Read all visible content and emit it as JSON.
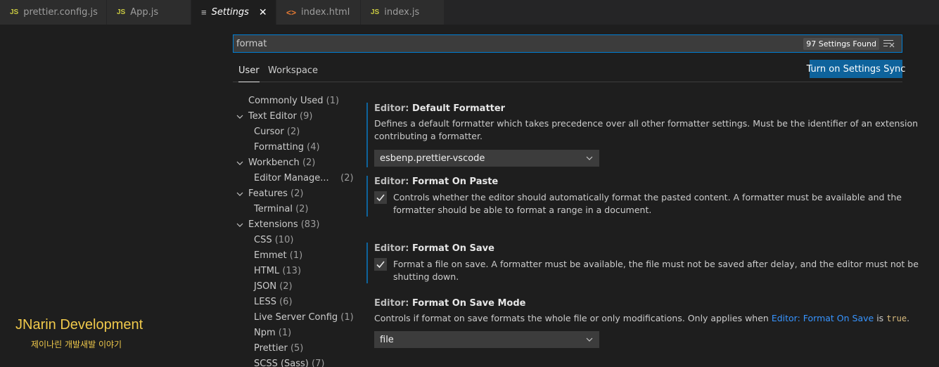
{
  "tabs": [
    {
      "icon": "JS",
      "label": "prettier.config.js"
    },
    {
      "icon": "JS",
      "label": "App.js"
    },
    {
      "icon": "≡",
      "label": "Settings",
      "active": true
    },
    {
      "icon": "<>",
      "label": "index.html"
    },
    {
      "icon": "JS",
      "label": "index.js"
    }
  ],
  "search": {
    "value": "format",
    "found": "97 Settings Found"
  },
  "scope": {
    "user": "User",
    "workspace": "Workspace"
  },
  "sync_button": "Turn on Settings Sync",
  "toc": [
    {
      "label": "Commonly Used",
      "count": "(1)"
    },
    {
      "label": "Text Editor",
      "count": "(9)"
    },
    {
      "label": "Cursor",
      "count": "(2)"
    },
    {
      "label": "Formatting",
      "count": "(4)"
    },
    {
      "label": "Workbench",
      "count": "(2)"
    },
    {
      "label": "Editor Manage...",
      "count": "(2)"
    },
    {
      "label": "Features",
      "count": "(2)"
    },
    {
      "label": "Terminal",
      "count": "(2)"
    },
    {
      "label": "Extensions",
      "count": "(83)"
    },
    {
      "label": "CSS",
      "count": "(10)"
    },
    {
      "label": "Emmet",
      "count": "(1)"
    },
    {
      "label": "HTML",
      "count": "(13)"
    },
    {
      "label": "JSON",
      "count": "(2)"
    },
    {
      "label": "LESS",
      "count": "(6)"
    },
    {
      "label": "Live Server Config",
      "count": "(1)"
    },
    {
      "label": "Npm",
      "count": "(1)"
    },
    {
      "label": "Prettier",
      "count": "(5)"
    },
    {
      "label": "SCSS (Sass)",
      "count": "(7)"
    }
  ],
  "settings": {
    "default_formatter": {
      "category": "Editor:",
      "name": "Default Formatter",
      "desc1": "Defines a default formatter which takes precedence over all other formatter settings. Must be the identifier of an extension",
      "desc2": "contributing a formatter.",
      "value": "esbenp.prettier-vscode"
    },
    "format_on_paste": {
      "category": "Editor:",
      "name": "Format On Paste",
      "desc1": "Controls whether the editor should automatically format the pasted content. A formatter must be available and the",
      "desc2": "formatter should be able to format a range in a document."
    },
    "format_on_save": {
      "category": "Editor:",
      "name": "Format On Save",
      "desc1": "Format a file on save. A formatter must be available, the file must not be saved after delay, and the editor must not be",
      "desc2": "shutting down."
    },
    "format_on_save_mode": {
      "category": "Editor:",
      "name": "Format On Save Mode",
      "desc_pre": "Controls if format on save formats the whole file or only modifications. Only applies when",
      "desc_link": "Editor: Format On Save",
      "desc_mid": "is",
      "desc_code": "true",
      "desc_end": ".",
      "value": "file"
    }
  },
  "watermark": {
    "title": "JNarin Development",
    "subtitle": "제이나린 개발새발 이야기"
  },
  "colors": {
    "accent": "#007fd4",
    "button": "#0e639c",
    "link": "#3794ff",
    "watermark": "#f0c94b"
  }
}
